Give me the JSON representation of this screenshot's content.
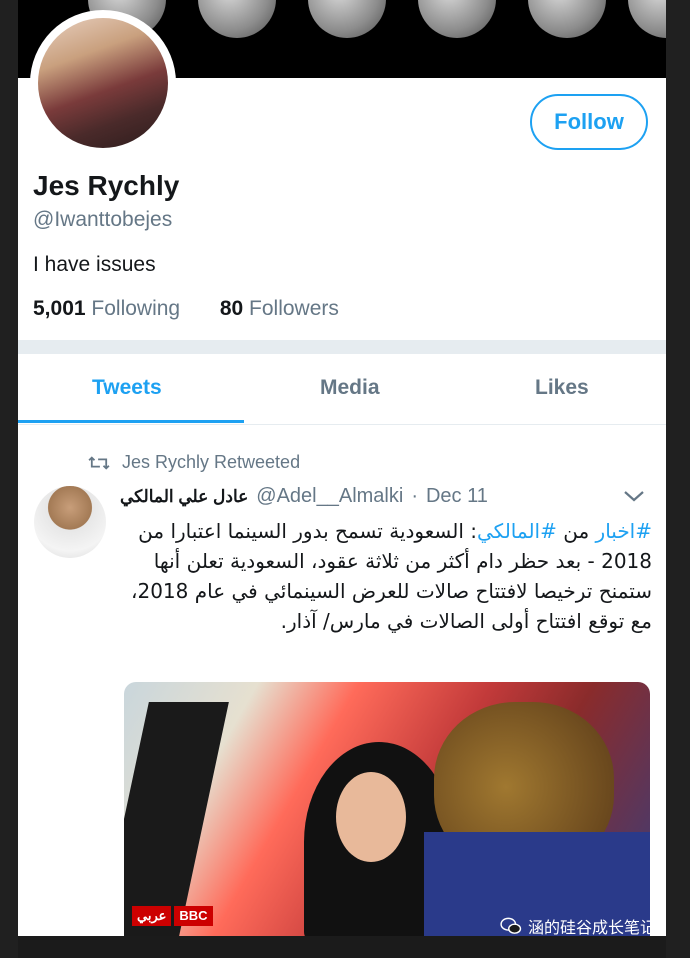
{
  "profile": {
    "name": "Jes Rychly",
    "handle": "@Iwanttobejes",
    "bio": "I have issues",
    "following_count": "5,001",
    "following_label": "Following",
    "followers_count": "80",
    "followers_label": "Followers",
    "follow_label": "Follow"
  },
  "tabs": [
    {
      "label": "Tweets",
      "active": true
    },
    {
      "label": "Media",
      "active": false
    },
    {
      "label": "Likes",
      "active": false
    }
  ],
  "tweet": {
    "retweet_line": "Jes Rychly Retweeted",
    "author": "عادل علي المالكي",
    "handle": "@Adel__Almalki",
    "date_sep": "·",
    "date": "Dec 11",
    "hashtag_news": "#اخبار",
    "word_from": " من ",
    "hashtag_malki": "#المالكي",
    "body": ": السعودية تسمح بدور السينما اعتبارا من 2018 - بعد حظر دام أكثر من ثلاثة عقود، السعودية تعلن أنها ستمنح ترخيصا لافتتاح صالات للعرض السينمائي في عام 2018، مع توقع افتتاح أولى الصالات في مارس/ آذار.",
    "media_badge_ar": "عربي",
    "media_badge_bbc": "BBC"
  },
  "watermark": {
    "text": "涵的硅谷成长笔记"
  },
  "colors": {
    "accent": "#1da1f2",
    "text": "#14171a",
    "muted": "#657786",
    "divider": "#e6ecf0"
  }
}
